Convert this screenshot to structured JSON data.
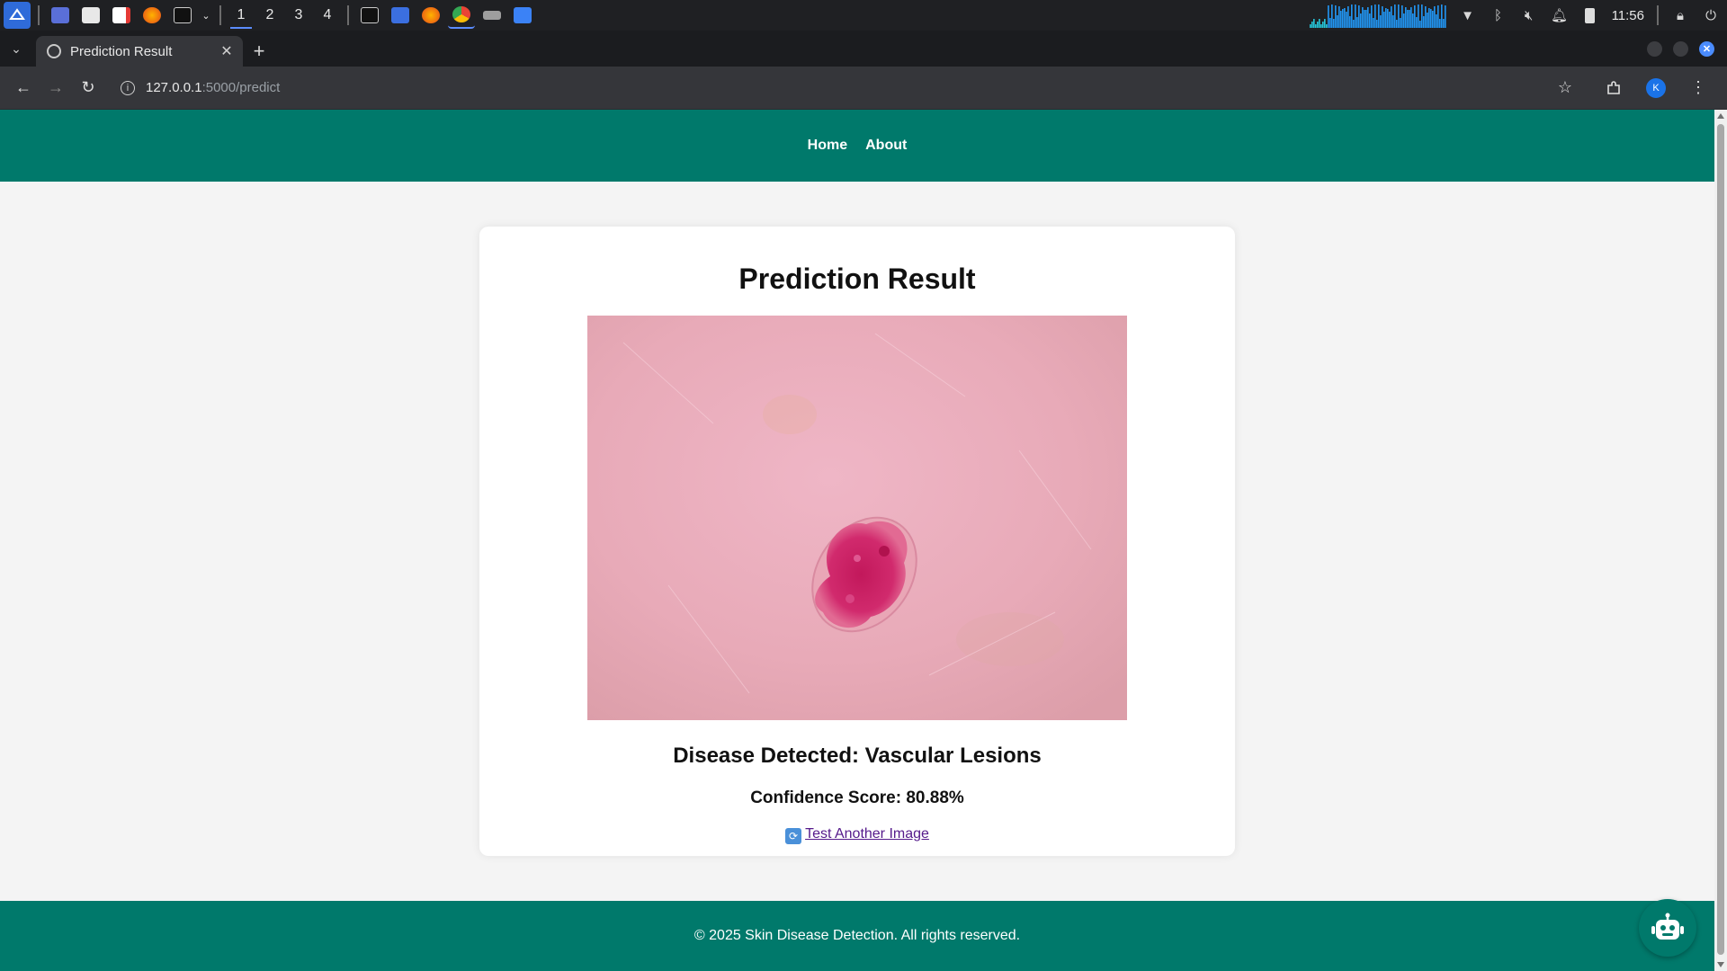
{
  "taskbar": {
    "workspaces": [
      "1",
      "2",
      "3",
      "4"
    ],
    "active_workspace": "1",
    "clock": "11:56",
    "apps": [
      "launcher-icon",
      "desktop-icon",
      "file-manager-icon",
      "text-editor-icon",
      "firefox-icon",
      "terminal-icon",
      "terminal-icon",
      "document-icon",
      "firefox-icon",
      "chrome-icon",
      "media-icon",
      "folder-icon"
    ],
    "tray": [
      "network-graph",
      "wifi-icon",
      "bluetooth-icon",
      "mute-icon",
      "bell-icon",
      "battery-icon",
      "lock-icon",
      "power-icon"
    ]
  },
  "browser": {
    "tab_title": "Prediction Result",
    "url_host": "127.0.0.1",
    "url_path": ":5000/predict",
    "profile_initial": "K"
  },
  "page": {
    "nav": {
      "home": "Home",
      "about": "About"
    },
    "title": "Prediction Result",
    "disease_line": "Disease Detected: Vascular Lesions",
    "confidence_line": "Confidence Score: 80.88%",
    "again_link": "Test Another Image",
    "footer": "© 2025 Skin Disease Detection. All rights reserved."
  },
  "colors": {
    "brand": "#00796b",
    "link": "#551a8b",
    "page_bg": "#f4f4f4"
  }
}
